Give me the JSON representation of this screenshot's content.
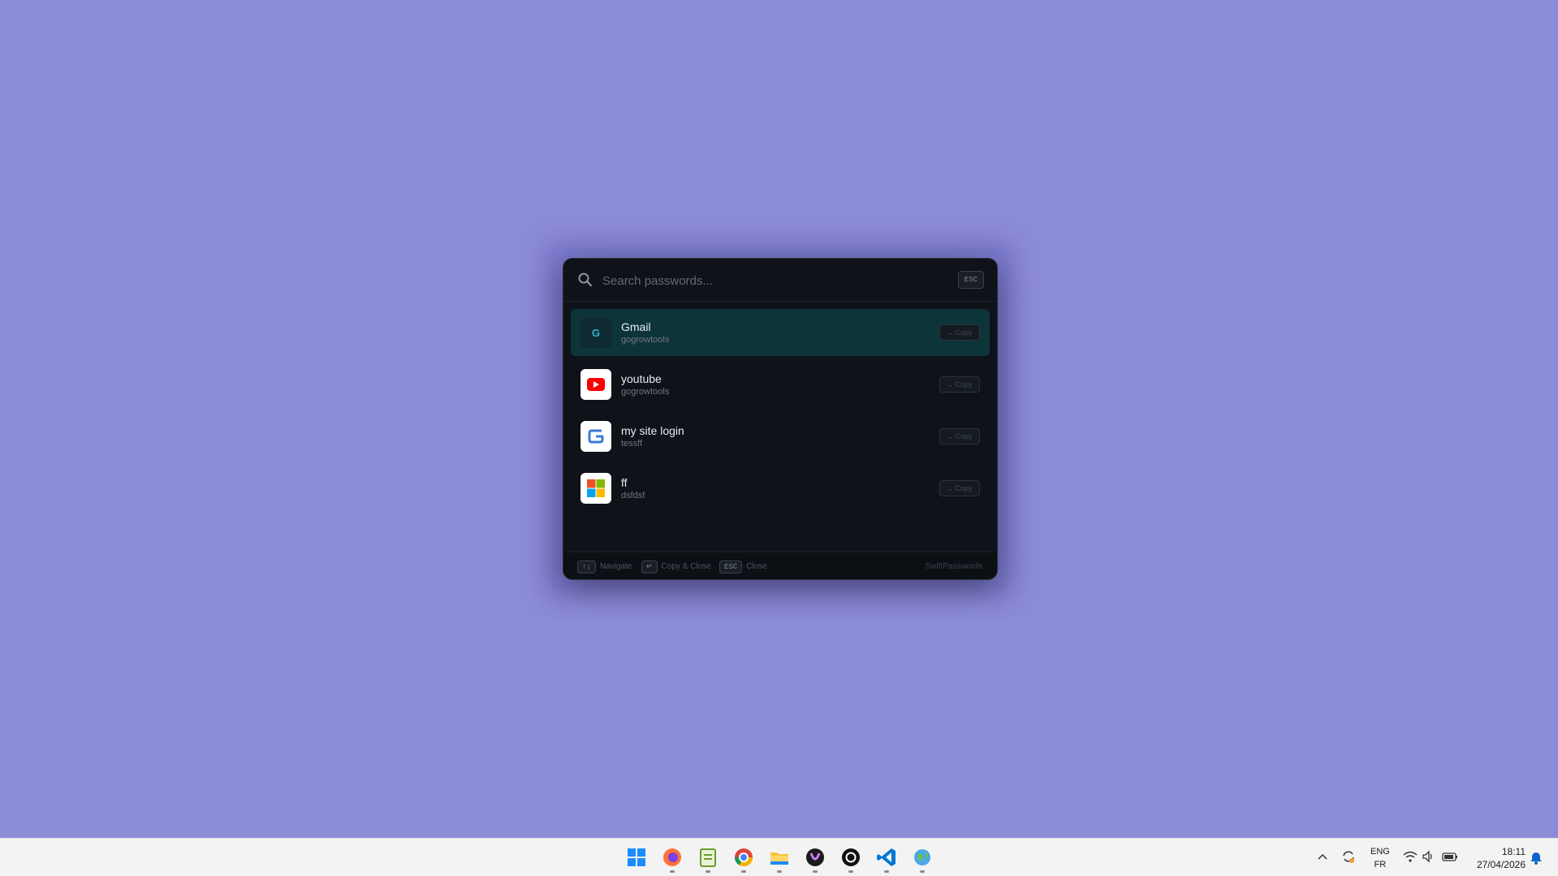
{
  "launcher": {
    "search_placeholder": "Search passwords...",
    "esc_badge": "ESC",
    "entries": [
      {
        "name": "Gmail",
        "username": "gogrowtools",
        "icon": "google-g-icon",
        "copy_label": "⌄ Copy",
        "selected": true
      },
      {
        "name": "youtube",
        "username": "gogrowtools",
        "icon": "youtube-icon",
        "copy_label": "⌄ Copy",
        "selected": false
      },
      {
        "name": "my site login",
        "username": "tessff",
        "icon": "g-logo-icon",
        "copy_label": "⌄ Copy",
        "selected": false
      },
      {
        "name": "ff",
        "username": "dsfdsf",
        "icon": "microsoft-icon",
        "copy_label": "⌄ Copy",
        "selected": false
      }
    ],
    "footer": {
      "navigate_key": "↑↓",
      "navigate_label": "Navigate",
      "copy_key": "↵",
      "copy_label": "Copy & Close",
      "close_key": "ESC",
      "close_label": "Close",
      "brand": "SwiftPasswords"
    }
  },
  "taskbar": {
    "apps": [
      "start-icon",
      "firefox-icon",
      "notepad-plus-icon",
      "chrome-icon",
      "file-explorer-icon",
      "app-icon-purple",
      "chatgpt-icon",
      "vscode-icon",
      "globe-app-icon"
    ],
    "language_top": "ENG",
    "language_bottom": "FR",
    "time": "18:11",
    "date": "27/04/2026"
  },
  "colors": {
    "desktop": "#8d8cd9",
    "panel": "#0f1218",
    "selected_row": "#0d3438",
    "accent": "#2bb6c9"
  }
}
